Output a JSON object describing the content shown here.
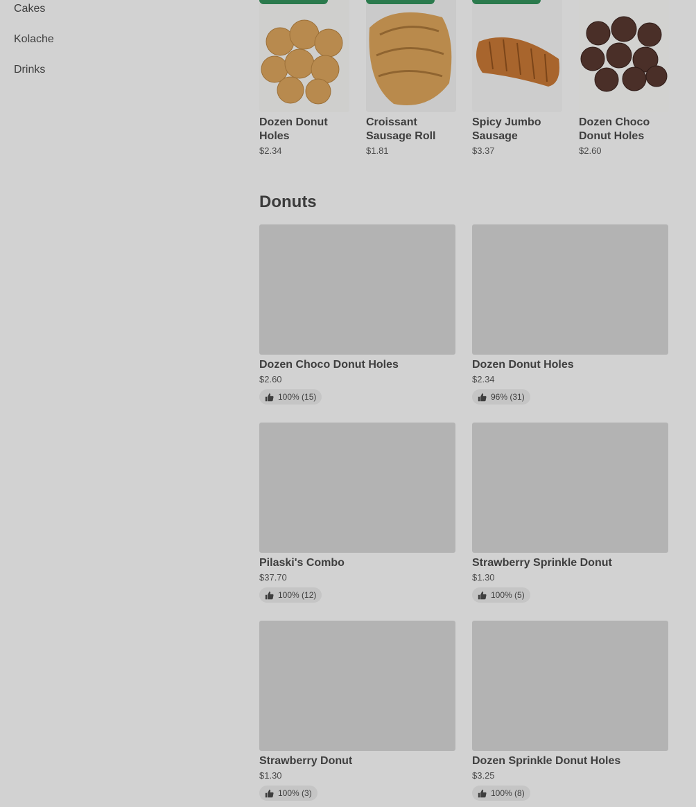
{
  "sidebar": {
    "items": [
      {
        "label": "Cakes"
      },
      {
        "label": "Kolache"
      },
      {
        "label": "Drinks"
      }
    ]
  },
  "featured": [
    {
      "title_line1": "Dozen Donut",
      "title_line2": "Holes",
      "price": "$2.34"
    },
    {
      "title_line1": "Croissant",
      "title_line2": "Sausage Roll",
      "price": "$1.81"
    },
    {
      "title_line1": "Spicy Jumbo",
      "title_line2": "Sausage",
      "price": "$3.37"
    },
    {
      "title_line1": "Dozen Choco",
      "title_line2": "Donut Holes",
      "price": "$2.60"
    }
  ],
  "section": {
    "title": "Donuts"
  },
  "items": [
    {
      "title": "Dozen Choco Donut Holes",
      "price": "$2.60",
      "rating": "100% (15)"
    },
    {
      "title": "Dozen Donut Holes",
      "price": "$2.34",
      "rating": "96% (31)"
    },
    {
      "title": "Pilaski's Combo",
      "price": "$37.70",
      "rating": "100% (12)"
    },
    {
      "title": "Strawberry Sprinkle Donut",
      "price": "$1.30",
      "rating": "100% (5)"
    },
    {
      "title": "Strawberry Donut",
      "price": "$1.30",
      "rating": "100% (3)"
    },
    {
      "title": "Dozen Sprinkle Donut Holes",
      "price": "$3.25",
      "rating": "100% (8)"
    }
  ],
  "colors": {
    "overlay": "#d2d2d2",
    "tag": "#2b7a4d",
    "placeholder": "#b3b3b3"
  }
}
